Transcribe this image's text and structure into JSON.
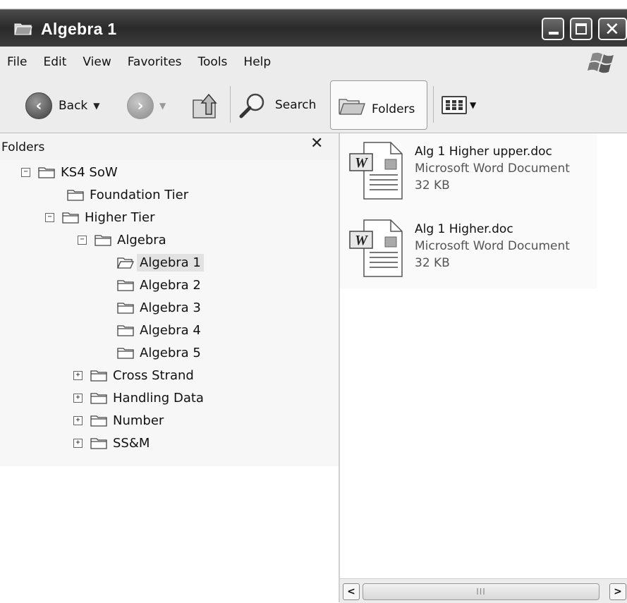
{
  "window": {
    "title": "Algebra 1",
    "controls": {
      "minimize": "minimize",
      "maximize": "maximize",
      "close": "close"
    }
  },
  "menubar": {
    "items": [
      "File",
      "Edit",
      "View",
      "Favorites",
      "Tools",
      "Help"
    ]
  },
  "toolbar": {
    "back_label": "Back",
    "search_label": "Search",
    "folders_label": "Folders"
  },
  "folders_pane": {
    "title": "Folders",
    "close_glyph": "✕",
    "tree": {
      "ks4": "KS4 SoW",
      "foundation": "Foundation Tier",
      "higher": "Higher Tier",
      "algebra": "Algebra",
      "algebra1": "Algebra 1",
      "algebra2": "Algebra 2",
      "algebra3": "Algebra 3",
      "algebra4": "Algebra 4",
      "algebra5": "Algebra 5",
      "cross_strand": "Cross Strand",
      "handling_data": "Handling Data",
      "number": "Number",
      "ssm": "SS&M"
    },
    "selected": "Algebra 1"
  },
  "files": [
    {
      "name": "Alg 1 Higher upper.doc",
      "type": "Microsoft Word Document",
      "size": "32 KB"
    },
    {
      "name": "Alg 1 Higher.doc",
      "type": "Microsoft Word Document",
      "size": "32 KB"
    }
  ],
  "scrollbar": {
    "grip": "III"
  },
  "icons": {
    "title": "folder-open-icon",
    "back": "arrow-left-icon",
    "forward": "arrow-right-icon",
    "up": "folder-up-icon",
    "search": "magnifier-icon",
    "folders": "folders-icon",
    "views": "views-icon",
    "file": "word-document-icon"
  },
  "colors": {
    "titlebar": "#2a2a2a",
    "selection": "#e2e2e2"
  }
}
